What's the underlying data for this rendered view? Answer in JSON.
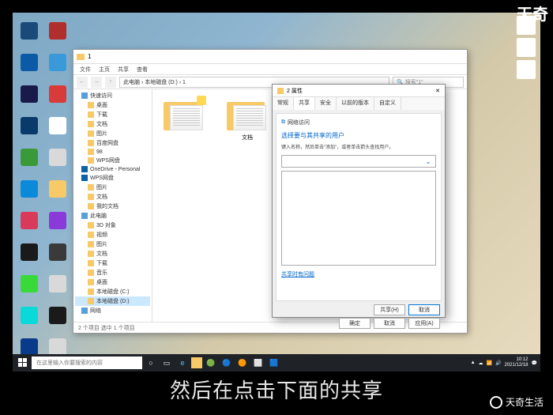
{
  "watermark_tr": "天奇",
  "watermark_br": "天奇生活",
  "caption": "然后在点击下面的共享",
  "desktop": {
    "icons": [
      {
        "label": "",
        "c": "#1a4a7a"
      },
      {
        "label": "",
        "c": "#b02e2e"
      },
      {
        "label": "",
        "c": "#0a5aa8"
      },
      {
        "label": "",
        "c": "#3a9ad9"
      },
      {
        "label": "",
        "c": "#1a1a4a"
      },
      {
        "label": "",
        "c": "#d93a3a"
      },
      {
        "label": "",
        "c": "#0a3a6a"
      },
      {
        "label": "",
        "c": "#ffffff"
      },
      {
        "label": "",
        "c": "#3a9a3a"
      },
      {
        "label": "",
        "c": "#d9d9d9"
      },
      {
        "label": "",
        "c": "#0a8ad9"
      },
      {
        "label": "",
        "c": "#f7c967"
      },
      {
        "label": "",
        "c": "#d93a5a"
      },
      {
        "label": "",
        "c": "#8a3ad9"
      },
      {
        "label": "",
        "c": "#1a1a1a"
      },
      {
        "label": "",
        "c": "#3a3a3a"
      },
      {
        "label": "",
        "c": "#3ad93a"
      },
      {
        "label": "",
        "c": "#d9d9d9"
      },
      {
        "label": "",
        "c": "#0ad9d9"
      },
      {
        "label": "",
        "c": "#1a1a1a"
      },
      {
        "label": "",
        "c": "#0a3a8a"
      },
      {
        "label": "",
        "c": "#d9d9d9"
      },
      {
        "label": "",
        "c": "#6a3a0a"
      },
      {
        "label": "",
        "c": "#d93a3a"
      }
    ]
  },
  "explorer": {
    "title": "1",
    "ribbon": [
      "文件",
      "主页",
      "共享",
      "查看"
    ],
    "path": "此电脑 › 本地磁盘 (D:) › 1",
    "search_placeholder": "搜索\"1\"",
    "tree_quick": "快速访问",
    "tree_items": [
      "桌面",
      "下载",
      "文档",
      "图片",
      "百度网盘",
      "98",
      "WPS网盘"
    ],
    "tree_onedrive": "OneDrive - Personal",
    "tree_wps": "WPS网盘",
    "tree_od_items": [
      "图片",
      "文档",
      "我的文档"
    ],
    "tree_pc": "此电脑",
    "tree_pc_items": [
      "3D 对象",
      "视频",
      "图片",
      "文档",
      "下载",
      "音乐",
      "桌面",
      "本地磁盘 (C:)",
      "本地磁盘 (D:)"
    ],
    "tree_network": "网络",
    "folder_name": "文档",
    "status": "2 个项目   选中 1 个项目"
  },
  "prop": {
    "title": "2 属性",
    "tabs": [
      "常规",
      "共享",
      "安全",
      "以前的版本",
      "自定义"
    ],
    "net_header": "网络访问",
    "headline": "选择要与其共享的用户",
    "desc": "键入名称，然后单击\"添加\"，或者单击箭头查找用户。",
    "share_link": "共享时有问题",
    "btn_share": "共享(H)",
    "btn_cancel_top": "取消",
    "btn_ok": "确定",
    "btn_cancel": "取消",
    "btn_apply": "应用(A)"
  },
  "taskbar": {
    "search": "在这里输入你要搜索的内容",
    "time": "10:12",
    "date": "2021/12/18"
  }
}
